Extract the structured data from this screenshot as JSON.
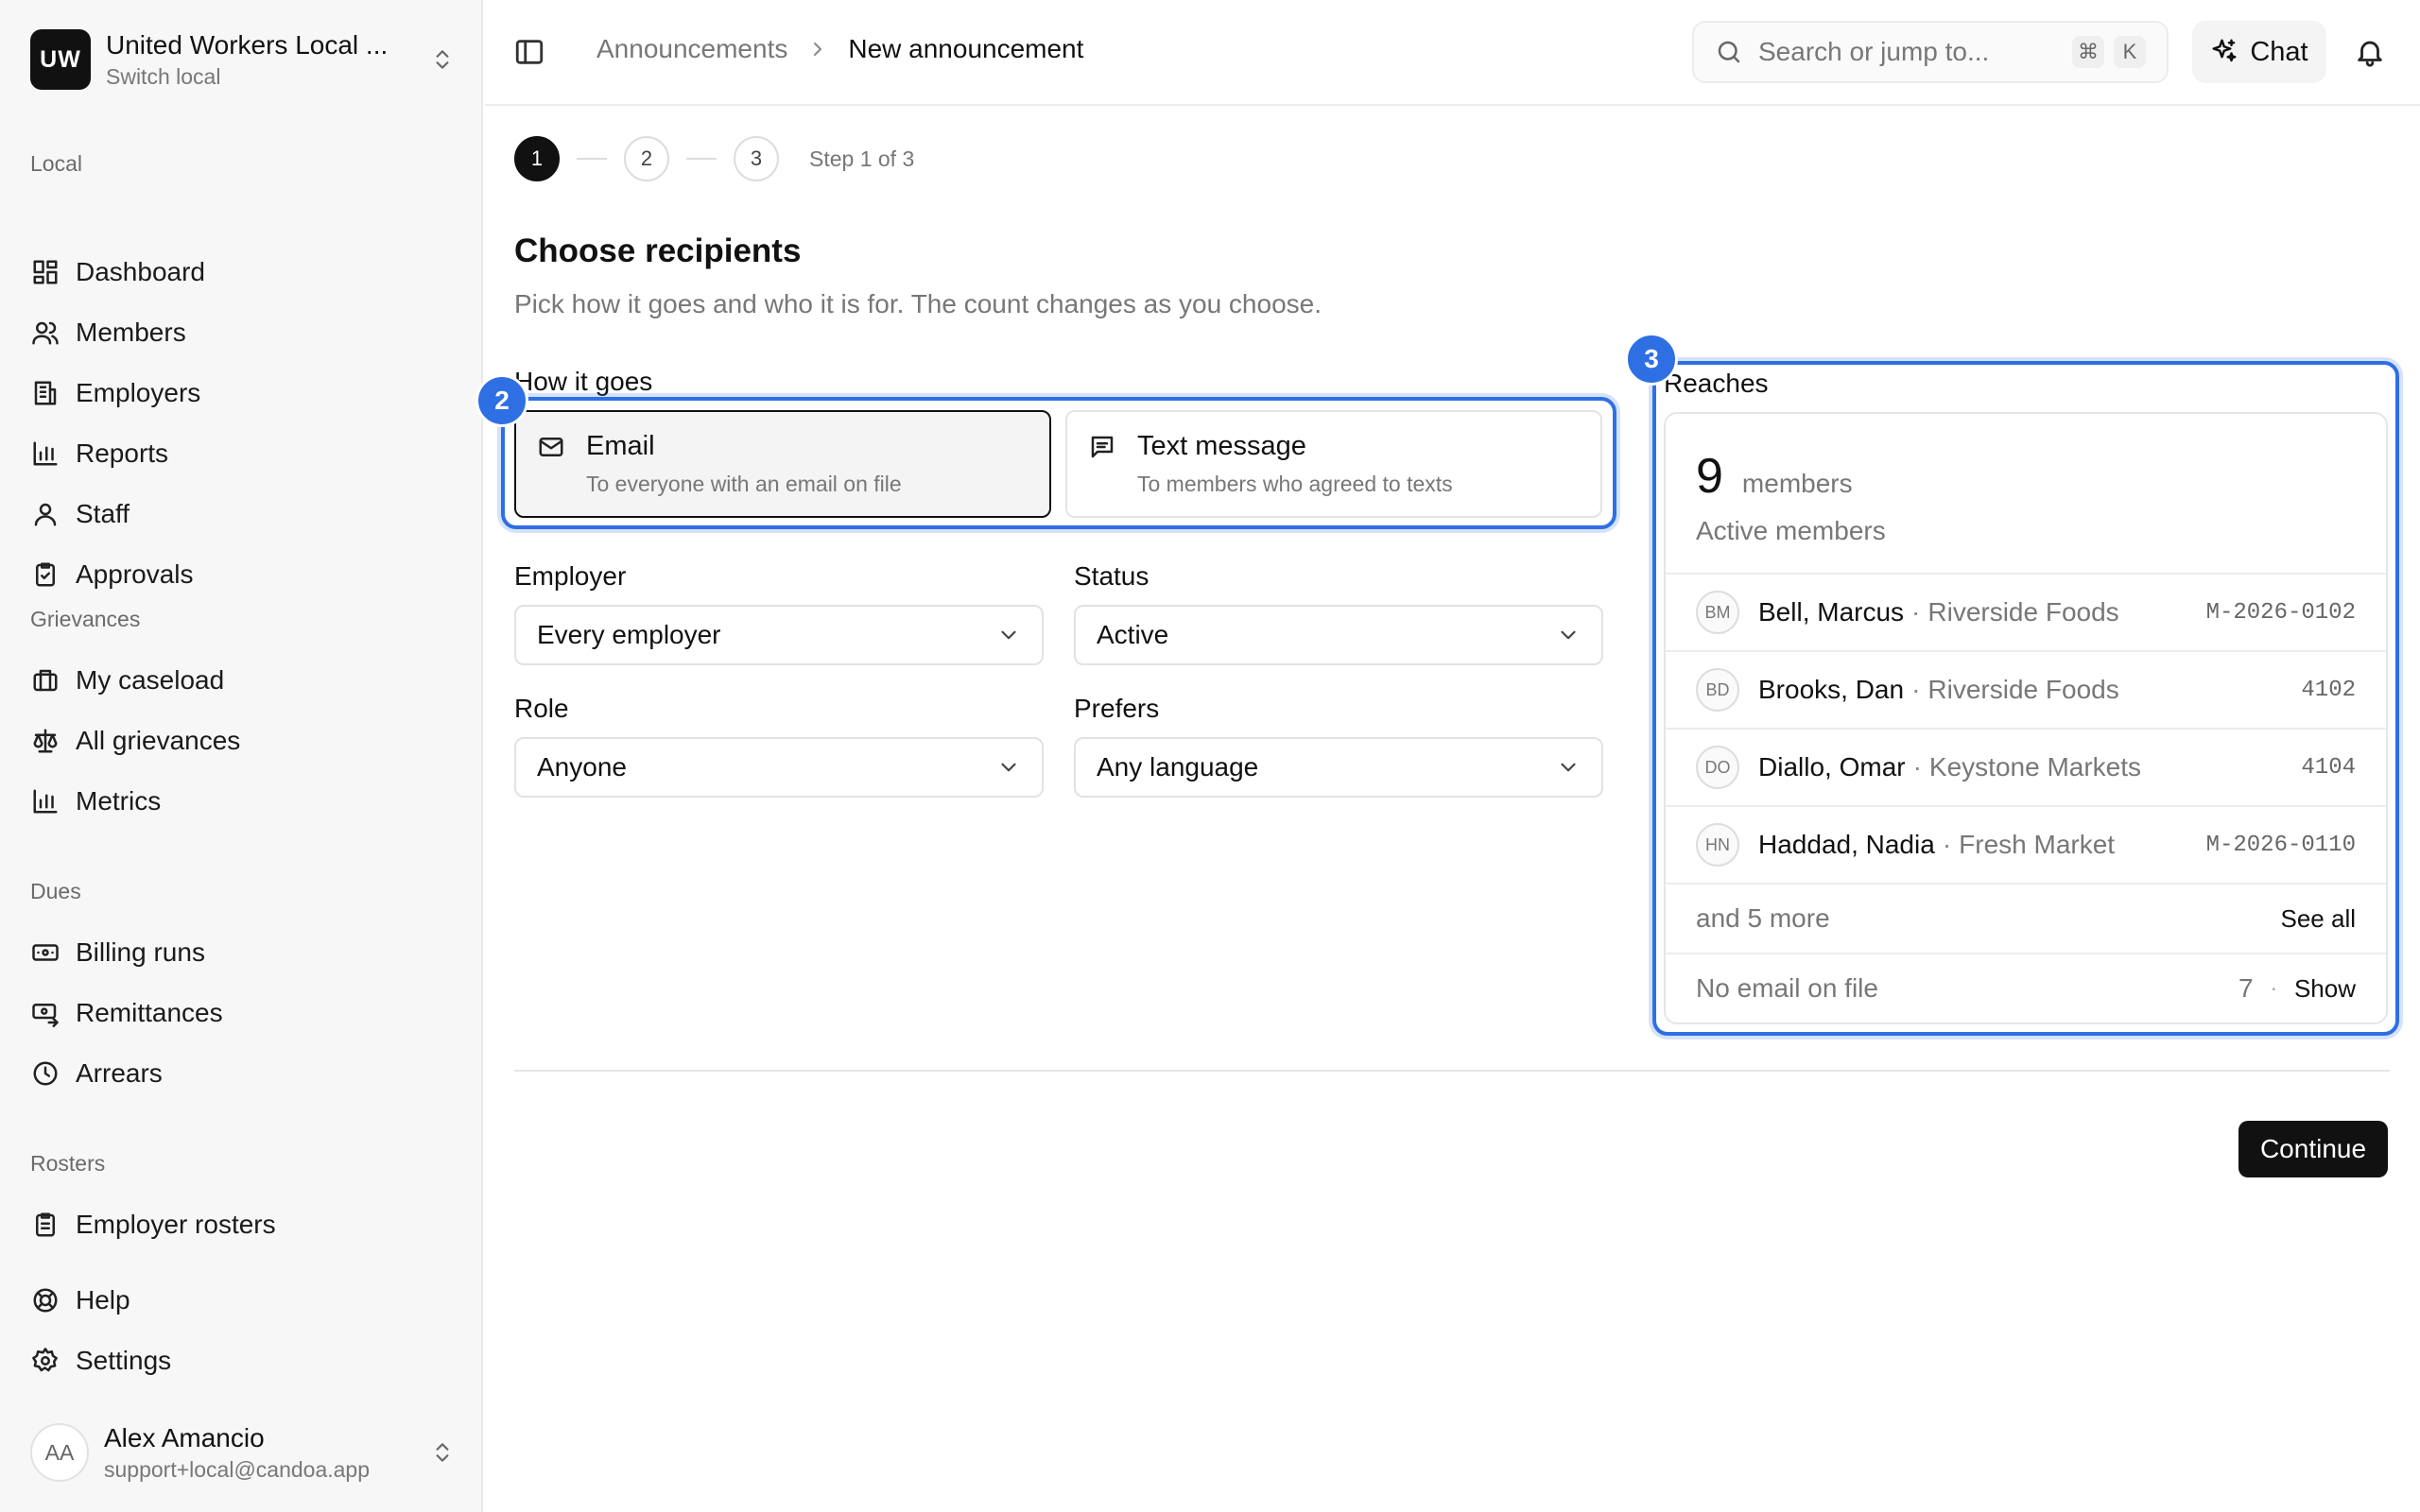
{
  "org": {
    "initials": "UW",
    "name": "United Workers Local ...",
    "sub": "Switch local"
  },
  "sidebar": {
    "sections": {
      "local": "Local",
      "grievances": "Grievances",
      "dues": "Dues",
      "rosters": "Rosters"
    },
    "items": {
      "dashboard": "Dashboard",
      "members": "Members",
      "employers": "Employers",
      "reports": "Reports",
      "staff": "Staff",
      "approvals": "Approvals",
      "my_caseload": "My caseload",
      "all_grievances": "All grievances",
      "metrics": "Metrics",
      "billing_runs": "Billing runs",
      "remittances": "Remittances",
      "arrears": "Arrears",
      "employer_rosters": "Employer rosters",
      "help": "Help",
      "settings": "Settings"
    }
  },
  "user": {
    "initials": "AA",
    "name": "Alex Amancio",
    "email": "support+local@candoa.app"
  },
  "header": {
    "breadcrumb": [
      "Announcements",
      "New announcement"
    ],
    "search_placeholder": "Search or jump to...",
    "shortcut": [
      "⌘",
      "K"
    ],
    "chat_label": "Chat"
  },
  "stepper": {
    "steps": [
      "1",
      "2",
      "3"
    ],
    "current_text": "Step 1 of 3"
  },
  "main": {
    "title": "Choose recipients",
    "subtitle": "Pick how it goes and who it is for. The count changes as you choose.",
    "how_label": "How it goes",
    "channels": [
      {
        "title": "Email",
        "desc": "To everyone with an email on file",
        "selected": true
      },
      {
        "title": "Text message",
        "desc": "To members who agreed to texts",
        "selected": false
      }
    ],
    "filters": {
      "employer": {
        "label": "Employer",
        "value": "Every employer"
      },
      "status": {
        "label": "Status",
        "value": "Active"
      },
      "role": {
        "label": "Role",
        "value": "Anyone"
      },
      "prefers": {
        "label": "Prefers",
        "value": "Any language"
      }
    },
    "badges": [
      "2",
      "3"
    ]
  },
  "reaches": {
    "label": "Reaches",
    "count": "9",
    "unit": "members",
    "subtitle": "Active members",
    "rows": [
      {
        "initials": "BM",
        "name": "Bell, Marcus",
        "sep": "·",
        "employer": "Riverside Foods",
        "id": "M-2026-0102"
      },
      {
        "initials": "BD",
        "name": "Brooks, Dan",
        "sep": "·",
        "employer": "Riverside Foods",
        "id": "4102"
      },
      {
        "initials": "DO",
        "name": "Diallo, Omar",
        "sep": "·",
        "employer": "Keystone Markets",
        "id": "4104"
      },
      {
        "initials": "HN",
        "name": "Haddad, Nadia",
        "sep": "·",
        "employer": "Fresh Market",
        "id": "M-2026-0110"
      }
    ],
    "more_text": "and 5 more",
    "see_all": "See all",
    "no_email_text": "No email on file",
    "no_email_count": "7",
    "dot": "·",
    "show_label": "Show"
  },
  "footer": {
    "continue_label": "Continue"
  }
}
